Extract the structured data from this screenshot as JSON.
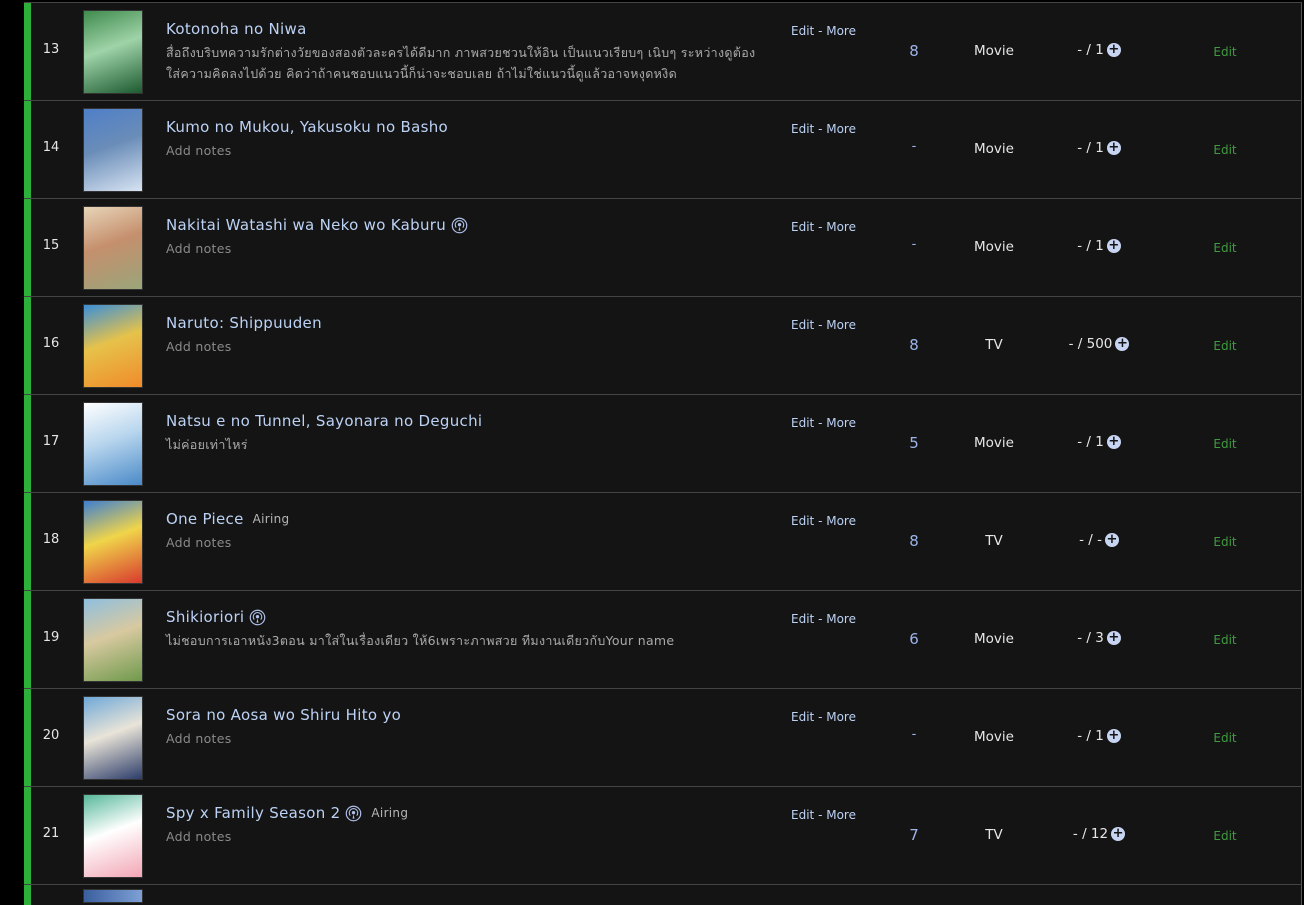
{
  "rows": [
    {
      "number": "13",
      "title": "Kotonoha no Niwa",
      "status": "",
      "has_cast_icon": false,
      "notes": "สื่อถึงบริบทความรักต่างวัยของสองตัวละครได้ดีมาก ภาพสวยชวนให้อิน เป็นแนวเรียบๆ เนิบๆ ระหว่างดูต้องใส่ความคิดลงไปด้วย คิดว่าถ้าคนชอบแนวนี้ก็น่าจะชอบเลย ถ้าไม่ใช่แนวนี้ดูแล้วอาจหงุดหงิด",
      "notes_placeholder": false,
      "edit_label": "Edit",
      "separator": " - ",
      "more_label": "More",
      "score": "8",
      "type": "Movie",
      "progress": "- / 1",
      "plus_icon": "+",
      "row_edit_label": "Edit",
      "thumb_colors": [
        "#3f8b4d",
        "#1d5a30",
        "#9fd3a8"
      ]
    },
    {
      "number": "14",
      "title": "Kumo no Mukou, Yakusoku no Basho",
      "status": "",
      "has_cast_icon": false,
      "notes": "Add notes",
      "notes_placeholder": true,
      "edit_label": "Edit",
      "separator": " - ",
      "more_label": "More",
      "score": "-",
      "type": "Movie",
      "progress": "- / 1",
      "plus_icon": "+",
      "row_edit_label": "Edit",
      "thumb_colors": [
        "#4f7fc8",
        "#d7e3f2",
        "#6a8db8"
      ]
    },
    {
      "number": "15",
      "title": "Nakitai Watashi wa Neko wo Kaburu",
      "status": "",
      "has_cast_icon": true,
      "notes": "Add notes",
      "notes_placeholder": true,
      "edit_label": "Edit",
      "separator": " - ",
      "more_label": "More",
      "score": "-",
      "type": "Movie",
      "progress": "- / 1",
      "plus_icon": "+",
      "row_edit_label": "Edit",
      "thumb_colors": [
        "#e7d5b8",
        "#9aa57a",
        "#c58f6d"
      ]
    },
    {
      "number": "16",
      "title": "Naruto: Shippuuden",
      "status": "",
      "has_cast_icon": false,
      "notes": "Add notes",
      "notes_placeholder": true,
      "edit_label": "Edit",
      "separator": " - ",
      "more_label": "More",
      "score": "8",
      "type": "TV",
      "progress": "- / 500",
      "plus_icon": "+",
      "row_edit_label": "Edit",
      "thumb_colors": [
        "#3b8fd8",
        "#f08b2a",
        "#e6c24a"
      ]
    },
    {
      "number": "17",
      "title": "Natsu e no Tunnel, Sayonara no Deguchi",
      "status": "",
      "has_cast_icon": false,
      "notes": "ไม่ค่อยเท่าไหร่",
      "notes_placeholder": false,
      "edit_label": "Edit",
      "separator": " - ",
      "more_label": "More",
      "score": "5",
      "type": "Movie",
      "progress": "- / 1",
      "plus_icon": "+",
      "row_edit_label": "Edit",
      "thumb_colors": [
        "#ffffff",
        "#4a8ac8",
        "#b9d6ee"
      ]
    },
    {
      "number": "18",
      "title": "One Piece",
      "status": "Airing",
      "has_cast_icon": false,
      "notes": "Add notes",
      "notes_placeholder": true,
      "edit_label": "Edit",
      "separator": " - ",
      "more_label": "More",
      "score": "8",
      "type": "TV",
      "progress": "- / -",
      "plus_icon": "+",
      "row_edit_label": "Edit",
      "thumb_colors": [
        "#3f7fd0",
        "#d83a2e",
        "#f0d54a"
      ]
    },
    {
      "number": "19",
      "title": "Shikioriori",
      "status": "",
      "has_cast_icon": true,
      "notes": "ไม่ชอบการเอาหนัง3ตอน มาใส่ในเรื่องเดียว ให้6เพราะภาพสวย ทีมงานเดียวกับYour name",
      "notes_placeholder": false,
      "edit_label": "Edit",
      "separator": " - ",
      "more_label": "More",
      "score": "6",
      "type": "Movie",
      "progress": "- / 3",
      "plus_icon": "+",
      "row_edit_label": "Edit",
      "thumb_colors": [
        "#8fbfdf",
        "#6f9a4c",
        "#d8c9a0"
      ]
    },
    {
      "number": "20",
      "title": "Sora no Aosa wo Shiru Hito yo",
      "status": "",
      "has_cast_icon": false,
      "notes": "Add notes",
      "notes_placeholder": true,
      "edit_label": "Edit",
      "separator": " - ",
      "more_label": "More",
      "score": "-",
      "type": "Movie",
      "progress": "- / 1",
      "plus_icon": "+",
      "row_edit_label": "Edit",
      "thumb_colors": [
        "#6fa8d8",
        "#2d3d6a",
        "#e9e4d8"
      ]
    },
    {
      "number": "21",
      "title": "Spy x Family Season 2",
      "status": "Airing",
      "has_cast_icon": true,
      "notes": "Add notes",
      "notes_placeholder": true,
      "edit_label": "Edit",
      "separator": " - ",
      "more_label": "More",
      "score": "7",
      "type": "TV",
      "progress": "- / 12",
      "plus_icon": "+",
      "row_edit_label": "Edit",
      "thumb_colors": [
        "#57b89a",
        "#f2a6b5",
        "#ffffff"
      ]
    }
  ],
  "colors": {
    "status_bar": "#2db039",
    "title": "#bcd2f5",
    "score": "#9cb4ea",
    "edit_link": "#3f9b3f",
    "row_bg": "#141414"
  }
}
